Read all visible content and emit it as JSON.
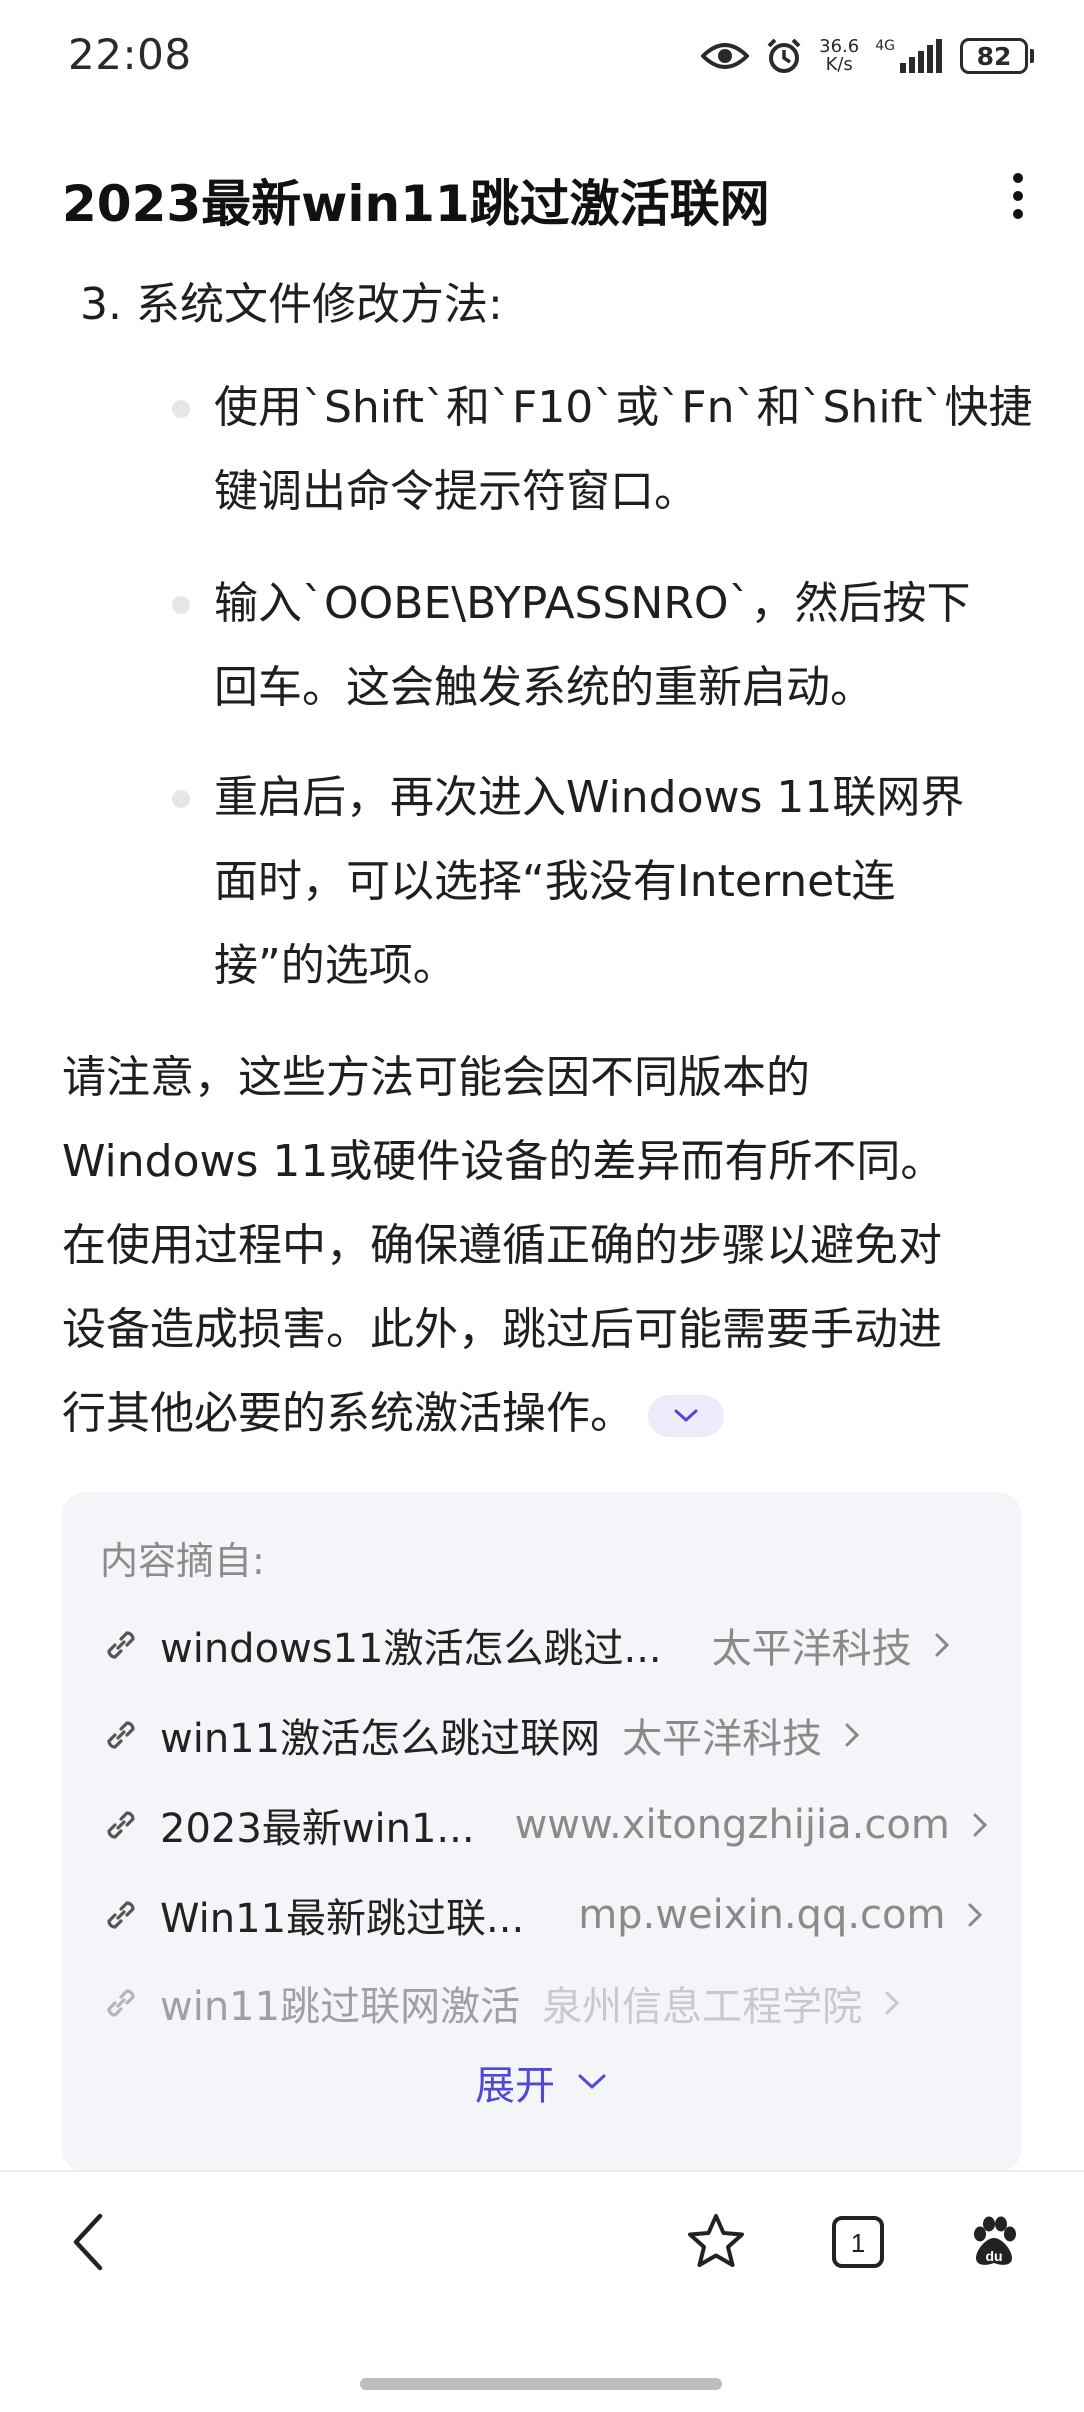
{
  "status_bar": {
    "time": "22:08",
    "net_speed_value": "36.6",
    "net_speed_unit": "K/s",
    "signal_label": "4G",
    "battery": "82",
    "icons": [
      "eye-icon",
      "alarm-icon",
      "signal-icon",
      "battery-icon"
    ]
  },
  "header": {
    "title": "2023最新win11跳过激活联网"
  },
  "article": {
    "step_heading": "3. 系统文件修改方法:",
    "bullets": [
      {
        "line1": "使用`Shift`和`F10`或`Fn`和`Shift`快捷",
        "line2": "键调出命令提示符窗口。",
        "line3": ""
      },
      {
        "line1": "输入`OOBE\\BYPASSNRO`，然后按下",
        "line2": "回车。这会触发系统的重新启动。",
        "line3": ""
      },
      {
        "line1": "重启后，再次进入Windows 11联网界",
        "line2": "面时，可以选择“我没有Internet连",
        "line3": "接”的选项。"
      }
    ],
    "note": {
      "line1": "请注意，这些方法可能会因不同版本的",
      "line2": "Windows 11或硬件设备的差异而有所不同。",
      "line3": "在使用过程中，确保遵循正确的步骤以避免对",
      "line4": "设备造成损害。此外，跳过后可能需要手动进",
      "line5": "行其他必要的系统激活操作。"
    }
  },
  "sources": {
    "label": "内容摘自:",
    "items": [
      {
        "title": "windows11激活怎么跳过...",
        "site": "太平洋科技"
      },
      {
        "title": "win11激活怎么跳过联网",
        "site": "太平洋科技"
      },
      {
        "title": "2023最新win1...",
        "site": "www.xitongzhijia.com"
      },
      {
        "title": "Win11最新跳过联...",
        "site": "mp.weixin.qq.com"
      },
      {
        "title": "win11跳过联网激活",
        "site": "泉州信息工程学院"
      }
    ],
    "expand_label": "展开"
  },
  "bottom_nav": {
    "tab_count": "1",
    "icons": [
      "back-icon",
      "star-icon",
      "tabs-icon",
      "baidu-paw-icon"
    ]
  },
  "colors": {
    "accent": "#5447d6",
    "card_bg": "#f4f5f9",
    "muted_text": "#8a8a8a"
  }
}
